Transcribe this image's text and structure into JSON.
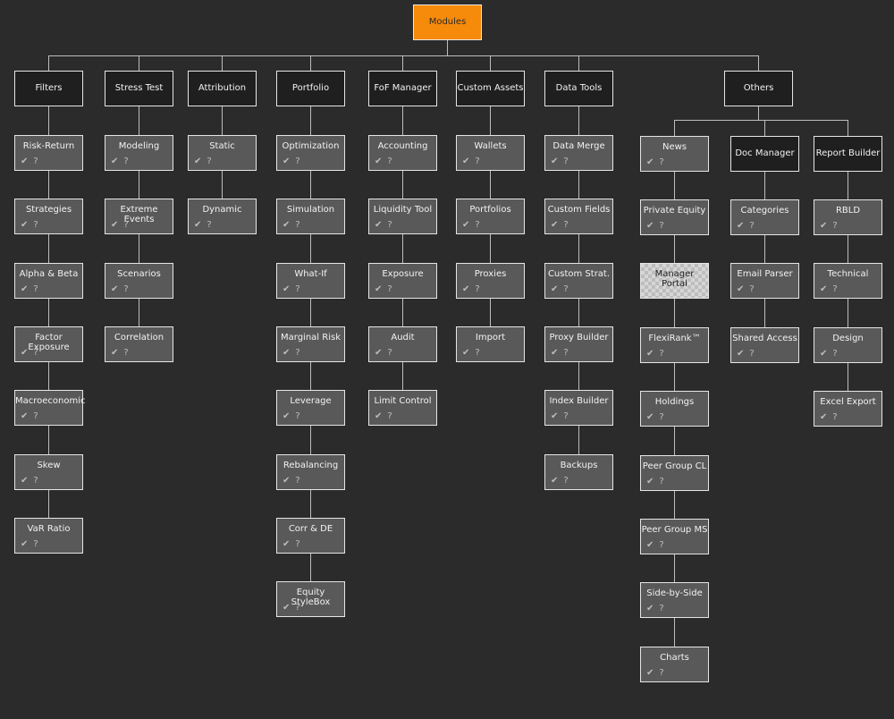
{
  "root": {
    "label": "Modules"
  },
  "icons": {
    "check": "✔",
    "help": "?"
  },
  "categories": [
    {
      "label": "Filters",
      "items": [
        "Risk-Return",
        "Strategies",
        "Alpha & Beta",
        "Factor Exposure",
        "Macroeconomic",
        "Skew",
        "VaR Ratio"
      ]
    },
    {
      "label": "Stress Test",
      "items": [
        "Modeling",
        "Extreme Events",
        "Scenarios",
        "Correlation"
      ]
    },
    {
      "label": "Attribution",
      "items": [
        "Static",
        "Dynamic"
      ]
    },
    {
      "label": "Portfolio",
      "items": [
        "Optimization",
        "Simulation",
        "What-If",
        "Marginal Risk",
        "Leverage",
        "Rebalancing",
        "Corr & DE",
        "Equity StyleBox"
      ]
    },
    {
      "label": "FoF Manager",
      "items": [
        "Accounting",
        "Liquidity Tool",
        "Exposure",
        "Audit",
        "Limit Control"
      ]
    },
    {
      "label": "Custom Assets",
      "items": [
        "Wallets",
        "Portfolios",
        "Proxies",
        "Import"
      ]
    },
    {
      "label": "Data Tools",
      "items": [
        "Data Merge",
        "Custom Fields",
        "Custom Strat.",
        "Proxy Builder",
        "Index Builder",
        "Backups"
      ]
    }
  ],
  "others": {
    "label": "Others",
    "groups": [
      {
        "label": "News",
        "is_leaf": true,
        "items": [
          "Private Equity",
          "Manager Portal",
          "FlexiRank™",
          "Holdings",
          "Peer Group CL",
          "Peer Group MS",
          "Side-by-Side",
          "Charts"
        ],
        "pending": [
          "Manager Portal"
        ]
      },
      {
        "label": "Doc Manager",
        "items": [
          "Categories",
          "Email Parser",
          "Shared Access"
        ]
      },
      {
        "label": "Report Builder",
        "items": [
          "RBLD",
          "Technical",
          "Design",
          "Excel Export"
        ]
      }
    ]
  }
}
